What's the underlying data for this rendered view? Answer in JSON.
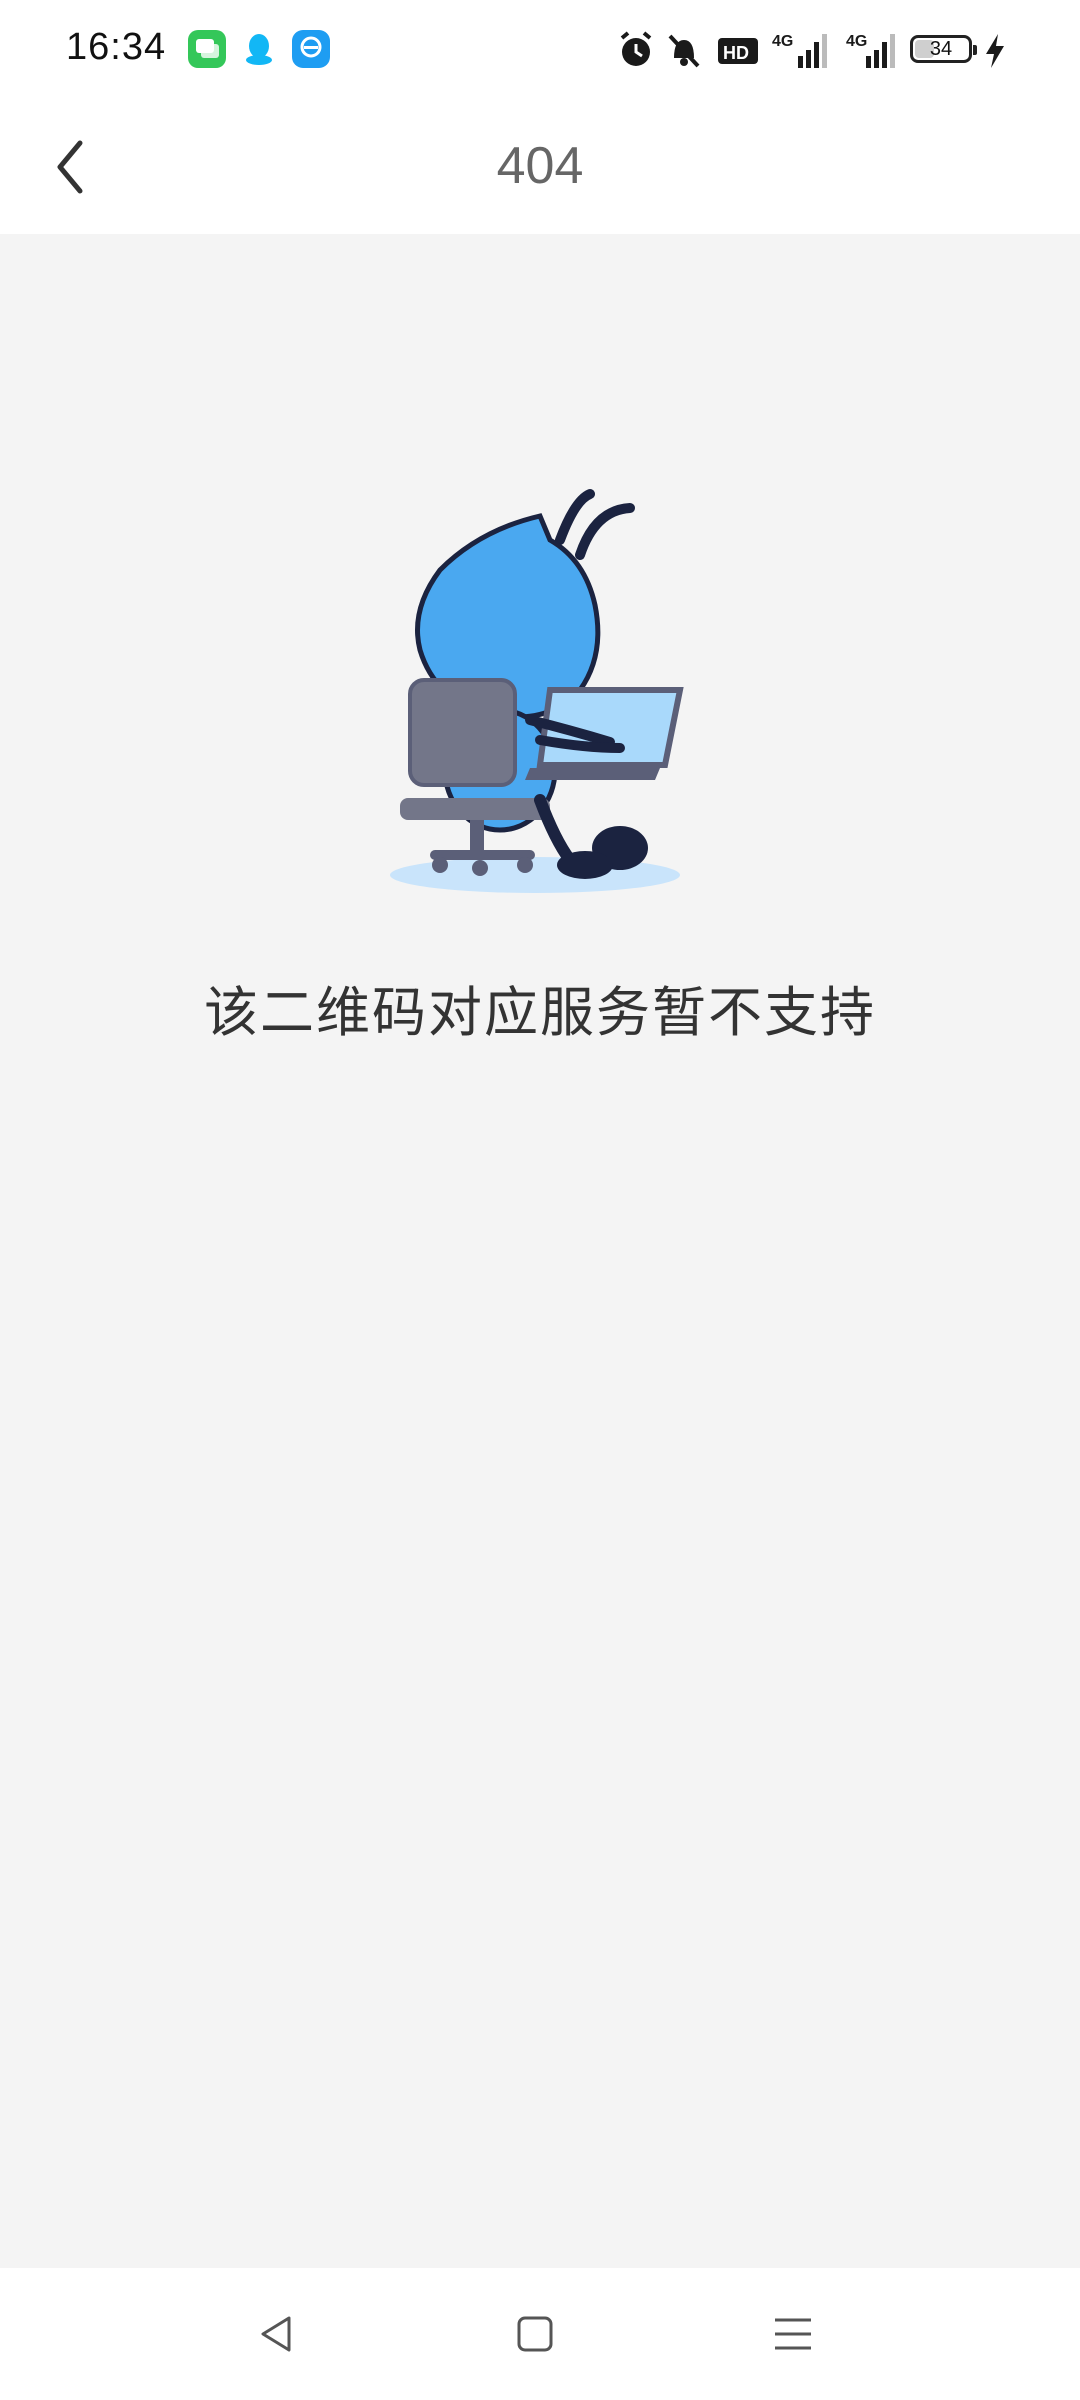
{
  "status_bar": {
    "time": "16:34",
    "network_1": "4G",
    "network_2": "4G",
    "hd": "HD",
    "battery_level": "34",
    "battery_percent": 34
  },
  "header": {
    "title": "404"
  },
  "content": {
    "message": "该二维码对应服务暂不支持"
  },
  "icons": {
    "back": "chevron-left-icon",
    "illustration": "ant-at-laptop-illustration",
    "sys_back": "triangle-back-icon",
    "sys_home": "square-home-icon",
    "sys_menu": "hamburger-menu-icon"
  },
  "colors": {
    "background": "#f4f4f4",
    "header_bg": "#ffffff",
    "title_text": "#666666",
    "message_text": "#333333",
    "ant_blue": "#4aa8f0"
  }
}
